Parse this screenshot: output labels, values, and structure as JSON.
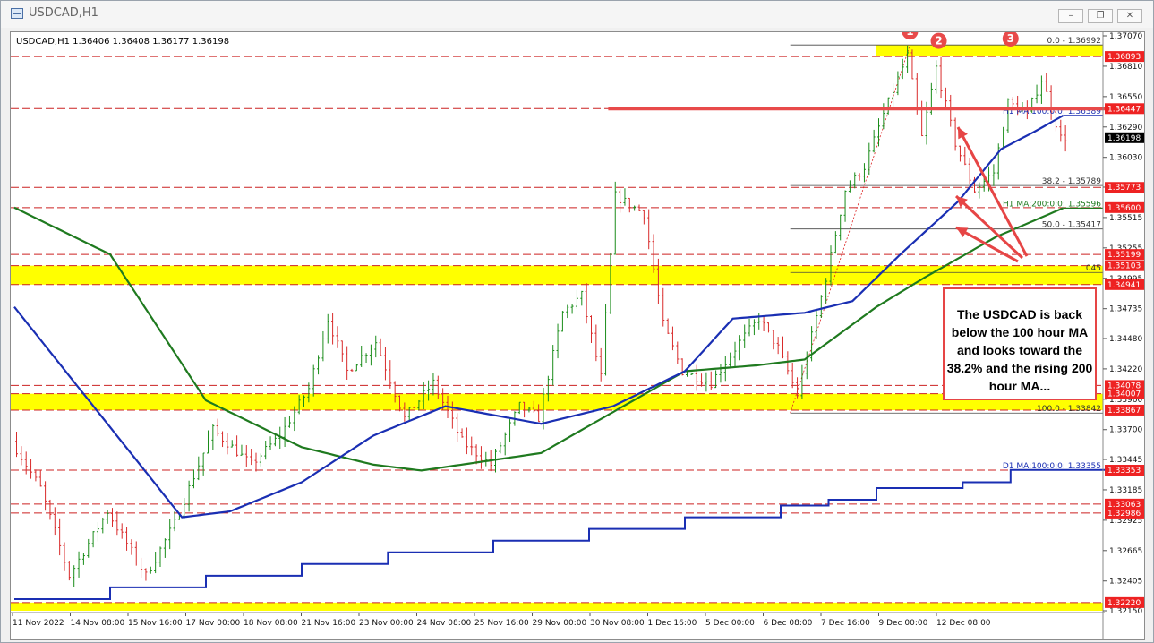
{
  "window": {
    "title": "USDCAD,H1",
    "minimize_glyph": "–",
    "restore_glyph": "❐",
    "close_glyph": "✕"
  },
  "header": {
    "info": "USDCAD,H1  1.36406 1.36408 1.36177 1.36198"
  },
  "annotation": {
    "text": "The USDCAD is back below the 100 hour MA and looks toward the 38.2% and the rising 200 hour MA..."
  },
  "markers": [
    "1",
    "2",
    "3"
  ],
  "colors": {
    "bull": "#1a8c1a",
    "bear": "#d92b2b",
    "ma100": "#1a2fb3",
    "ma200": "#1f7a1f",
    "d1ma": "#1a2fb3",
    "zone": "#ffff00",
    "level": "#c22",
    "annotation": "#e64545"
  },
  "chart_data": {
    "type": "candlestick",
    "symbol": "USDCAD",
    "timeframe": "H1",
    "ylim": [
      1.3215,
      1.3707
    ],
    "y_ticks": [
      "1.37070",
      "1.36810",
      "1.36550",
      "1.36290",
      "1.36030",
      "1.35775",
      "1.35515",
      "1.35255",
      "1.34995",
      "1.34735",
      "1.34480",
      "1.34220",
      "1.33960",
      "1.33700",
      "1.33445",
      "1.33185",
      "1.32925",
      "1.32665",
      "1.32405",
      "1.32150"
    ],
    "x_ticks": [
      "11 Nov 2022",
      "14 Nov 08:00",
      "15 Nov 16:00",
      "17 Nov 00:00",
      "18 Nov 08:00",
      "21 Nov 16:00",
      "23 Nov 00:00",
      "24 Nov 08:00",
      "25 Nov 16:00",
      "29 Nov 00:00",
      "30 Nov 08:00",
      "1 Dec 16:00",
      "5 Dec 00:00",
      "6 Dec 08:00",
      "7 Dec 16:00",
      "9 Dec 00:00",
      "12 Dec 08:00"
    ],
    "price_labels": [
      {
        "text": "1.36893",
        "value": 1.36893,
        "style": "red"
      },
      {
        "text": "1.36447",
        "value": 1.36447,
        "style": "red"
      },
      {
        "text": "1.36198",
        "value": 1.36198,
        "style": "current"
      },
      {
        "text": "1.35773",
        "value": 1.35773,
        "style": "red"
      },
      {
        "text": "1.35600",
        "value": 1.356,
        "style": "red"
      },
      {
        "text": "1.35199",
        "value": 1.35199,
        "style": "red"
      },
      {
        "text": "1.35103",
        "value": 1.35103,
        "style": "red"
      },
      {
        "text": "1.34941",
        "value": 1.34941,
        "style": "red"
      },
      {
        "text": "1.34078",
        "value": 1.34078,
        "style": "red"
      },
      {
        "text": "1.34007",
        "value": 1.34007,
        "style": "red"
      },
      {
        "text": "1.33867",
        "value": 1.33867,
        "style": "red"
      },
      {
        "text": "1.33353",
        "value": 1.33353,
        "style": "red"
      },
      {
        "text": "1.33063",
        "value": 1.33063,
        "style": "red"
      },
      {
        "text": "1.32986",
        "value": 1.32986,
        "style": "red"
      },
      {
        "text": "1.32220",
        "value": 1.3222,
        "style": "red"
      }
    ],
    "horizontal_levels": [
      1.36893,
      1.36447,
      1.35773,
      1.356,
      1.35199,
      1.35103,
      1.34941,
      1.34078,
      1.34007,
      1.33867,
      1.33353,
      1.33063,
      1.32986,
      1.3222
    ],
    "zones": [
      {
        "from": 1.36893,
        "to": 1.36992,
        "start_bar": 180
      },
      {
        "from": 1.34941,
        "to": 1.35103,
        "start_bar": 0
      },
      {
        "from": 1.33867,
        "to": 1.34007,
        "start_bar": 0
      },
      {
        "from": 1.3215,
        "to": 1.3222,
        "start_bar": 0
      }
    ],
    "fibonacci": [
      {
        "label": "0.0 - 1.36992",
        "value": 1.36992
      },
      {
        "label": "38.2 - 1.35789",
        "value": 1.35789
      },
      {
        "label": "50.0 - 1.35417",
        "value": 1.35417
      },
      {
        "label": "045",
        "value": 1.35045
      },
      {
        "label": "100.0 - 1.33842",
        "value": 1.33842
      }
    ],
    "fib_start_bar": 162,
    "ma_labels": [
      {
        "label": "H1 MA:100:0:0: 1.36389",
        "value": 1.36389
      },
      {
        "label": "H1 MA:200:0:0: 1.35596",
        "value": 1.35596
      },
      {
        "label": "D1 MA:100:0:0: 1.33355",
        "value": 1.33355
      }
    ],
    "trend_line": {
      "value": 1.36447,
      "from_bar": 124,
      "to_bar": 232
    },
    "peaks": [
      {
        "label": "1",
        "bar": 187,
        "value": 1.37
      },
      {
        "label": "2",
        "bar": 193,
        "value": 1.3692
      },
      {
        "label": "3",
        "bar": 208,
        "value": 1.3694
      }
    ],
    "bars": 220,
    "ma100_anchors": [
      [
        0,
        1.3475
      ],
      [
        35,
        1.3295
      ],
      [
        45,
        1.33
      ],
      [
        60,
        1.3325
      ],
      [
        75,
        1.3365
      ],
      [
        90,
        1.339
      ],
      [
        110,
        1.3375
      ],
      [
        125,
        1.339
      ],
      [
        140,
        1.342
      ],
      [
        150,
        1.3465
      ],
      [
        165,
        1.347
      ],
      [
        175,
        1.348
      ],
      [
        185,
        1.352
      ],
      [
        197,
        1.3565
      ],
      [
        206,
        1.361
      ],
      [
        213,
        1.3625
      ],
      [
        219,
        1.36389
      ]
    ],
    "ma200_anchors": [
      [
        0,
        1.356
      ],
      [
        20,
        1.352
      ],
      [
        40,
        1.3395
      ],
      [
        60,
        1.3355
      ],
      [
        75,
        1.334
      ],
      [
        85,
        1.3335
      ],
      [
        110,
        1.335
      ],
      [
        125,
        1.3385
      ],
      [
        140,
        1.342
      ],
      [
        155,
        1.3425
      ],
      [
        165,
        1.343
      ],
      [
        180,
        1.3475
      ],
      [
        190,
        1.35
      ],
      [
        205,
        1.3535
      ],
      [
        219,
        1.35596
      ]
    ],
    "d1_steps": [
      [
        0,
        1.3225
      ],
      [
        20,
        1.3235
      ],
      [
        40,
        1.3245
      ],
      [
        60,
        1.3255
      ],
      [
        78,
        1.3265
      ],
      [
        100,
        1.3275
      ],
      [
        120,
        1.3285
      ],
      [
        140,
        1.3295
      ],
      [
        160,
        1.3305
      ],
      [
        170,
        1.331
      ],
      [
        180,
        1.332
      ],
      [
        198,
        1.3325
      ],
      [
        208,
        1.33355
      ],
      [
        232,
        1.33355
      ]
    ],
    "price_path": [
      [
        0,
        1.336
      ],
      [
        6,
        1.332
      ],
      [
        12,
        1.3245
      ],
      [
        20,
        1.33
      ],
      [
        28,
        1.3245
      ],
      [
        34,
        1.329
      ],
      [
        42,
        1.337
      ],
      [
        50,
        1.334
      ],
      [
        56,
        1.3365
      ],
      [
        62,
        1.3405
      ],
      [
        66,
        1.3465
      ],
      [
        70,
        1.342
      ],
      [
        76,
        1.3445
      ],
      [
        82,
        1.338
      ],
      [
        88,
        1.341
      ],
      [
        94,
        1.336
      ],
      [
        100,
        1.334
      ],
      [
        106,
        1.339
      ],
      [
        110,
        1.338
      ],
      [
        115,
        1.347
      ],
      [
        119,
        1.3485
      ],
      [
        123,
        1.3415
      ],
      [
        126,
        1.357
      ],
      [
        132,
        1.3555
      ],
      [
        136,
        1.346
      ],
      [
        140,
        1.342
      ],
      [
        146,
        1.341
      ],
      [
        152,
        1.3445
      ],
      [
        156,
        1.3465
      ],
      [
        160,
        1.344
      ],
      [
        164,
        1.34
      ],
      [
        170,
        1.35
      ],
      [
        174,
        1.3575
      ],
      [
        178,
        1.3595
      ],
      [
        182,
        1.364
      ],
      [
        187,
        1.369
      ],
      [
        190,
        1.362
      ],
      [
        193,
        1.368
      ],
      [
        197,
        1.3615
      ],
      [
        201,
        1.3575
      ],
      [
        205,
        1.359
      ],
      [
        208,
        1.365
      ],
      [
        212,
        1.364
      ],
      [
        215,
        1.367
      ],
      [
        219,
        1.36198
      ]
    ]
  }
}
